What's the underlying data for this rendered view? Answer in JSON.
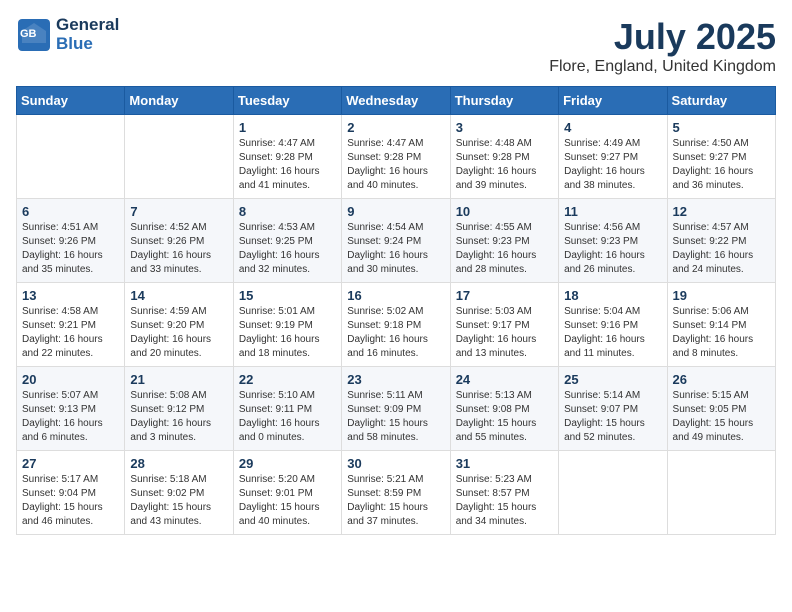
{
  "logo": {
    "line1": "General",
    "line2": "Blue"
  },
  "title": "July 2025",
  "location": "Flore, England, United Kingdom",
  "weekdays": [
    "Sunday",
    "Monday",
    "Tuesday",
    "Wednesday",
    "Thursday",
    "Friday",
    "Saturday"
  ],
  "weeks": [
    [
      {
        "day": "",
        "text": ""
      },
      {
        "day": "",
        "text": ""
      },
      {
        "day": "1",
        "text": "Sunrise: 4:47 AM\nSunset: 9:28 PM\nDaylight: 16 hours\nand 41 minutes."
      },
      {
        "day": "2",
        "text": "Sunrise: 4:47 AM\nSunset: 9:28 PM\nDaylight: 16 hours\nand 40 minutes."
      },
      {
        "day": "3",
        "text": "Sunrise: 4:48 AM\nSunset: 9:28 PM\nDaylight: 16 hours\nand 39 minutes."
      },
      {
        "day": "4",
        "text": "Sunrise: 4:49 AM\nSunset: 9:27 PM\nDaylight: 16 hours\nand 38 minutes."
      },
      {
        "day": "5",
        "text": "Sunrise: 4:50 AM\nSunset: 9:27 PM\nDaylight: 16 hours\nand 36 minutes."
      }
    ],
    [
      {
        "day": "6",
        "text": "Sunrise: 4:51 AM\nSunset: 9:26 PM\nDaylight: 16 hours\nand 35 minutes."
      },
      {
        "day": "7",
        "text": "Sunrise: 4:52 AM\nSunset: 9:26 PM\nDaylight: 16 hours\nand 33 minutes."
      },
      {
        "day": "8",
        "text": "Sunrise: 4:53 AM\nSunset: 9:25 PM\nDaylight: 16 hours\nand 32 minutes."
      },
      {
        "day": "9",
        "text": "Sunrise: 4:54 AM\nSunset: 9:24 PM\nDaylight: 16 hours\nand 30 minutes."
      },
      {
        "day": "10",
        "text": "Sunrise: 4:55 AM\nSunset: 9:23 PM\nDaylight: 16 hours\nand 28 minutes."
      },
      {
        "day": "11",
        "text": "Sunrise: 4:56 AM\nSunset: 9:23 PM\nDaylight: 16 hours\nand 26 minutes."
      },
      {
        "day": "12",
        "text": "Sunrise: 4:57 AM\nSunset: 9:22 PM\nDaylight: 16 hours\nand 24 minutes."
      }
    ],
    [
      {
        "day": "13",
        "text": "Sunrise: 4:58 AM\nSunset: 9:21 PM\nDaylight: 16 hours\nand 22 minutes."
      },
      {
        "day": "14",
        "text": "Sunrise: 4:59 AM\nSunset: 9:20 PM\nDaylight: 16 hours\nand 20 minutes."
      },
      {
        "day": "15",
        "text": "Sunrise: 5:01 AM\nSunset: 9:19 PM\nDaylight: 16 hours\nand 18 minutes."
      },
      {
        "day": "16",
        "text": "Sunrise: 5:02 AM\nSunset: 9:18 PM\nDaylight: 16 hours\nand 16 minutes."
      },
      {
        "day": "17",
        "text": "Sunrise: 5:03 AM\nSunset: 9:17 PM\nDaylight: 16 hours\nand 13 minutes."
      },
      {
        "day": "18",
        "text": "Sunrise: 5:04 AM\nSunset: 9:16 PM\nDaylight: 16 hours\nand 11 minutes."
      },
      {
        "day": "19",
        "text": "Sunrise: 5:06 AM\nSunset: 9:14 PM\nDaylight: 16 hours\nand 8 minutes."
      }
    ],
    [
      {
        "day": "20",
        "text": "Sunrise: 5:07 AM\nSunset: 9:13 PM\nDaylight: 16 hours\nand 6 minutes."
      },
      {
        "day": "21",
        "text": "Sunrise: 5:08 AM\nSunset: 9:12 PM\nDaylight: 16 hours\nand 3 minutes."
      },
      {
        "day": "22",
        "text": "Sunrise: 5:10 AM\nSunset: 9:11 PM\nDaylight: 16 hours\nand 0 minutes."
      },
      {
        "day": "23",
        "text": "Sunrise: 5:11 AM\nSunset: 9:09 PM\nDaylight: 15 hours\nand 58 minutes."
      },
      {
        "day": "24",
        "text": "Sunrise: 5:13 AM\nSunset: 9:08 PM\nDaylight: 15 hours\nand 55 minutes."
      },
      {
        "day": "25",
        "text": "Sunrise: 5:14 AM\nSunset: 9:07 PM\nDaylight: 15 hours\nand 52 minutes."
      },
      {
        "day": "26",
        "text": "Sunrise: 5:15 AM\nSunset: 9:05 PM\nDaylight: 15 hours\nand 49 minutes."
      }
    ],
    [
      {
        "day": "27",
        "text": "Sunrise: 5:17 AM\nSunset: 9:04 PM\nDaylight: 15 hours\nand 46 minutes."
      },
      {
        "day": "28",
        "text": "Sunrise: 5:18 AM\nSunset: 9:02 PM\nDaylight: 15 hours\nand 43 minutes."
      },
      {
        "day": "29",
        "text": "Sunrise: 5:20 AM\nSunset: 9:01 PM\nDaylight: 15 hours\nand 40 minutes."
      },
      {
        "day": "30",
        "text": "Sunrise: 5:21 AM\nSunset: 8:59 PM\nDaylight: 15 hours\nand 37 minutes."
      },
      {
        "day": "31",
        "text": "Sunrise: 5:23 AM\nSunset: 8:57 PM\nDaylight: 15 hours\nand 34 minutes."
      },
      {
        "day": "",
        "text": ""
      },
      {
        "day": "",
        "text": ""
      }
    ]
  ]
}
